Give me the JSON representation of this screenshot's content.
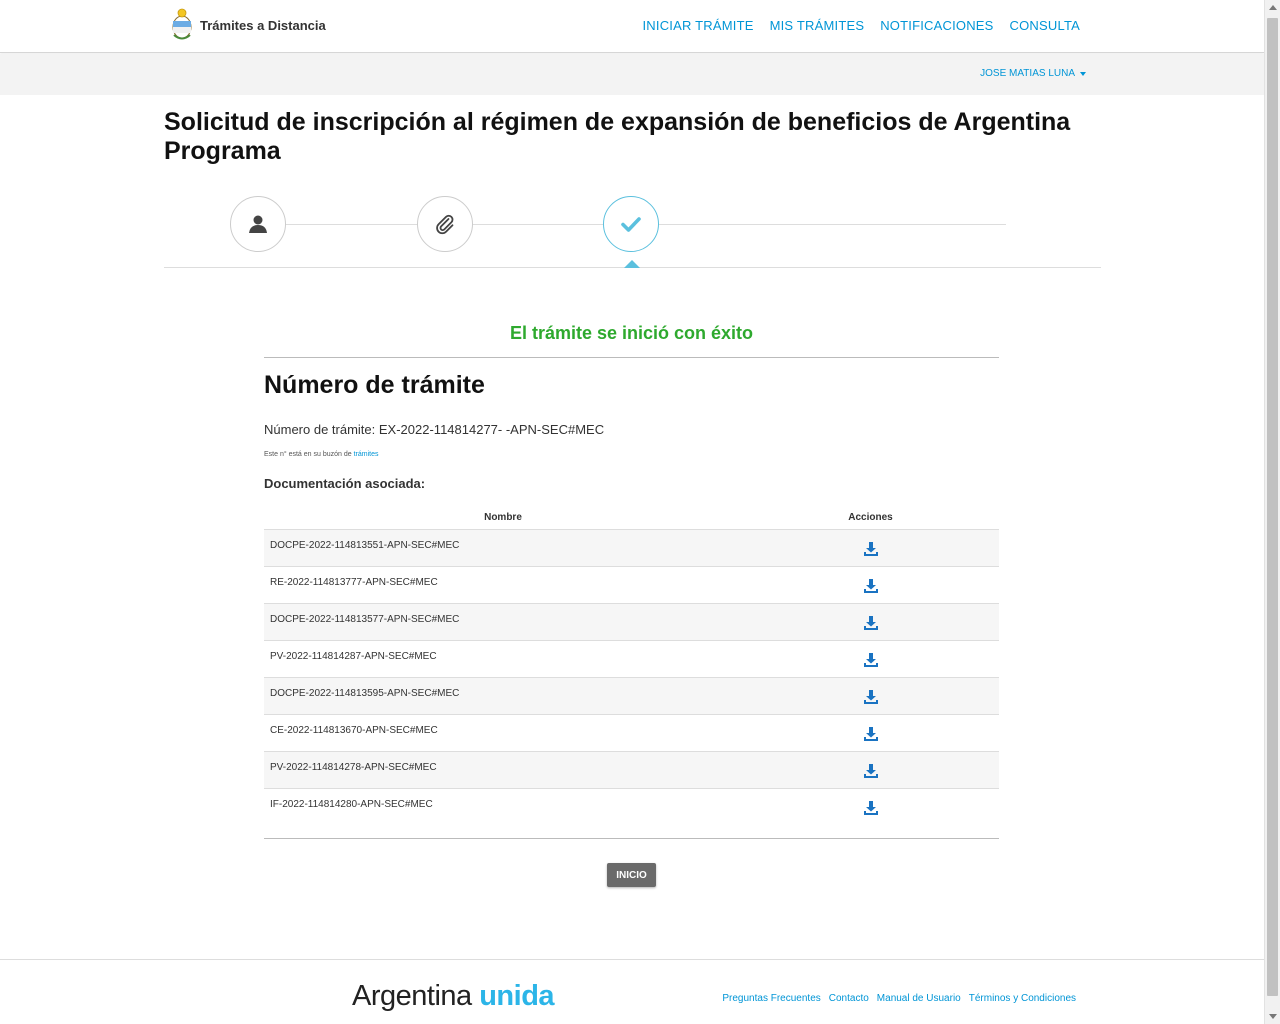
{
  "header": {
    "brand": "Trámites a Distancia",
    "nav": [
      "INICIAR TRÁMITE",
      "MIS TRÁMITES",
      "NOTIFICACIONES",
      "CONSULTA"
    ]
  },
  "userbar": {
    "user": "JOSE MATIAS LUNA"
  },
  "page": {
    "title": "Solicitud de inscripción al régimen de expansión de beneficios de Argentina Programa"
  },
  "stepper": {
    "steps": [
      {
        "icon": "user-icon",
        "state": "done"
      },
      {
        "icon": "paperclip-icon",
        "state": "done"
      },
      {
        "icon": "check-icon",
        "state": "active"
      }
    ],
    "active_color": "#5bc0de"
  },
  "result": {
    "success_message": "El trámite se inició con éxito",
    "success_color": "#2ea92e",
    "section_title": "Número de trámite",
    "tramite_label": "Número de trámite:",
    "tramite_number": "EX-2022-114814277- -APN-SEC#MEC",
    "note_text": "Este n° está en su buzón de",
    "note_link": "trámites",
    "docs_label": "Documentación asociada:"
  },
  "table": {
    "headers": {
      "nombre": "Nombre",
      "acciones": "Acciones"
    },
    "rows": [
      "DOCPE-2022-114813551-APN-SEC#MEC",
      "RE-2022-114813777-APN-SEC#MEC",
      "DOCPE-2022-114813577-APN-SEC#MEC",
      "PV-2022-114814287-APN-SEC#MEC",
      "DOCPE-2022-114813595-APN-SEC#MEC",
      "CE-2022-114813670-APN-SEC#MEC",
      "PV-2022-114814278-APN-SEC#MEC",
      "IF-2022-114814280-APN-SEC#MEC"
    ],
    "action_icon": "download-icon"
  },
  "actions": {
    "inicio_label": "INICIO"
  },
  "footer": {
    "brand_main": "Argentina",
    "brand_accent": "unida",
    "links": [
      "Preguntas Frecuentes",
      "Contacto",
      "Manual de Usuario",
      "Términos y Condiciones"
    ]
  },
  "colors": {
    "link": "#0095d6",
    "accent": "#2cb5e8",
    "download": "#1a73c2"
  }
}
